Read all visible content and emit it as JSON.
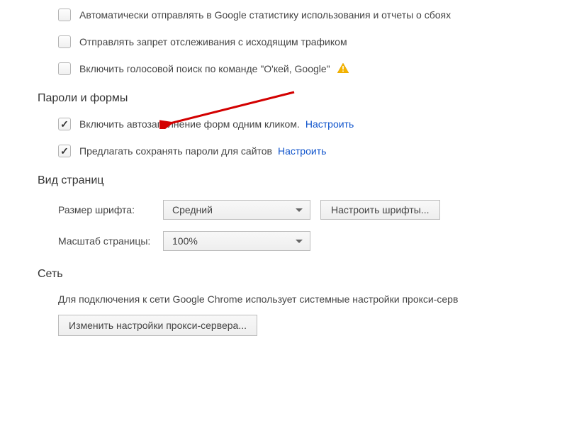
{
  "privacy": {
    "option_stats": "Автоматически отправлять в Google статистику использования и отчеты о сбоях",
    "option_dnt": "Отправлять запрет отслеживания с исходящим трафиком",
    "option_voice": "Включить голосовой поиск по команде \"О'кей, Google\""
  },
  "passwords": {
    "title": "Пароли и формы",
    "autofill_label": "Включить автозаполнение форм одним кликом.",
    "autofill_link": "Настроить",
    "save_passwords_label": "Предлагать сохранять пароли для сайтов",
    "save_passwords_link": "Настроить"
  },
  "appearance": {
    "title": "Вид страниц",
    "font_size_label": "Размер шрифта:",
    "font_size_value": "Средний",
    "customize_fonts_button": "Настроить шрифты...",
    "zoom_label": "Масштаб страницы:",
    "zoom_value": "100%"
  },
  "network": {
    "title": "Сеть",
    "description": "Для подключения к сети Google Chrome использует системные настройки прокси-серв",
    "proxy_button": "Изменить настройки прокси-сервера..."
  }
}
